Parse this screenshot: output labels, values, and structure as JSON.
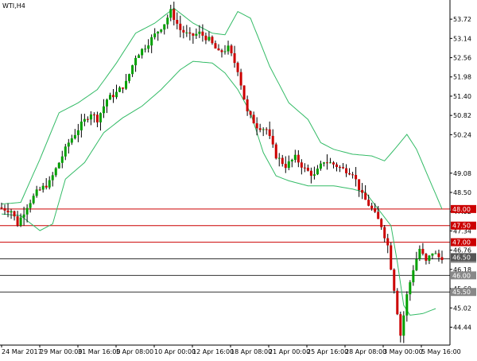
{
  "window": {
    "title": "WTI,H4"
  },
  "colors": {
    "background": "#ffffff",
    "bull": "#00a000",
    "bear": "#cc0000",
    "wick": "#000000",
    "band": "#33bb66",
    "red_level": "#cc0000",
    "gray_level": "#333333",
    "axis": "#000000",
    "label_text": "#ffffff"
  },
  "chart_data": {
    "type": "candlestick",
    "symbol": "WTI",
    "timeframe": "H4",
    "title": "WTI,H4",
    "y_range": [
      43.9,
      54.25
    ],
    "y_ticks": [
      "53.72",
      "53.14",
      "52.56",
      "51.98",
      "51.40",
      "50.82",
      "50.24",
      "49.08",
      "48.50",
      "47.92",
      "47.34",
      "46.76",
      "46.18",
      "45.60",
      "45.02",
      "44.44"
    ],
    "x_labels": [
      "24 Mar 2017",
      "29 Mar 00:00",
      "31 Mar 16:00",
      "5 Apr 08:00",
      "10 Apr 00:00",
      "12 Apr 16:00",
      "18 Apr 08:00",
      "21 Apr 00:00",
      "25 Apr 16:00",
      "28 Apr 08:00",
      "3 May 00:00",
      "5 May 16:00"
    ],
    "levels": [
      {
        "value": 48.0,
        "label": "48.00",
        "kind": "red"
      },
      {
        "value": 47.5,
        "label": "47.50",
        "kind": "red"
      },
      {
        "value": 47.0,
        "label": "47.00",
        "kind": "red"
      },
      {
        "value": 46.5,
        "label": "46.50",
        "kind": "gray"
      },
      {
        "value": 46.0,
        "label": "46.00",
        "kind": "gray"
      },
      {
        "value": 45.5,
        "label": "45.50",
        "kind": "gray"
      }
    ],
    "current_price": {
      "value": 46.55,
      "label": "46.50"
    },
    "price_path": [
      [
        0,
        48.05
      ],
      [
        4,
        47.95
      ],
      [
        6,
        47.55
      ],
      [
        9,
        48.1
      ],
      [
        12,
        48.5
      ],
      [
        16,
        48.8
      ],
      [
        19,
        49.4
      ],
      [
        22,
        50.0
      ],
      [
        26,
        50.55
      ],
      [
        29,
        50.9
      ],
      [
        31,
        50.7
      ],
      [
        34,
        51.3
      ],
      [
        37,
        51.5
      ],
      [
        40,
        51.8
      ],
      [
        43,
        52.6
      ],
      [
        46,
        52.9
      ],
      [
        49,
        53.25
      ],
      [
        52,
        53.6
      ],
      [
        54,
        53.95
      ],
      [
        57,
        53.4
      ],
      [
        60,
        53.2
      ],
      [
        63,
        53.3
      ],
      [
        66,
        53.1
      ],
      [
        69,
        52.7
      ],
      [
        72,
        52.85
      ],
      [
        75,
        52.2
      ],
      [
        78,
        50.9
      ],
      [
        81,
        50.5
      ],
      [
        84,
        50.4
      ],
      [
        87,
        49.6
      ],
      [
        90,
        49.3
      ],
      [
        93,
        49.55
      ],
      [
        96,
        49.2
      ],
      [
        99,
        49.0
      ],
      [
        102,
        49.45
      ],
      [
        105,
        49.35
      ],
      [
        108,
        49.2
      ],
      [
        111,
        49.1
      ],
      [
        114,
        48.4
      ],
      [
        117,
        48.0
      ],
      [
        120,
        47.5
      ],
      [
        122,
        46.9
      ],
      [
        124,
        45.6
      ],
      [
        126,
        44.2
      ],
      [
        128,
        45.4
      ],
      [
        130,
        46.2
      ],
      [
        132,
        46.8
      ],
      [
        134,
        46.4
      ],
      [
        136,
        46.7
      ],
      [
        138,
        46.55
      ]
    ],
    "upper_band": [
      [
        0,
        48.15
      ],
      [
        6,
        48.2
      ],
      [
        12,
        49.5
      ],
      [
        18,
        50.9
      ],
      [
        24,
        51.2
      ],
      [
        30,
        51.6
      ],
      [
        36,
        52.4
      ],
      [
        42,
        53.3
      ],
      [
        48,
        53.6
      ],
      [
        54,
        54.05
      ],
      [
        60,
        53.6
      ],
      [
        66,
        53.3
      ],
      [
        70,
        53.25
      ],
      [
        74,
        53.95
      ],
      [
        78,
        53.75
      ],
      [
        84,
        52.3
      ],
      [
        90,
        51.2
      ],
      [
        96,
        50.7
      ],
      [
        100,
        50.0
      ],
      [
        104,
        49.8
      ],
      [
        110,
        49.65
      ],
      [
        116,
        49.6
      ],
      [
        120,
        49.45
      ],
      [
        124,
        49.9
      ],
      [
        127,
        50.25
      ],
      [
        130,
        49.8
      ],
      [
        134,
        48.9
      ],
      [
        138,
        48.0
      ]
    ],
    "lower_band": [
      [
        0,
        47.85
      ],
      [
        6,
        47.8
      ],
      [
        12,
        47.35
      ],
      [
        16,
        47.55
      ],
      [
        20,
        48.9
      ],
      [
        26,
        49.4
      ],
      [
        32,
        50.3
      ],
      [
        38,
        50.75
      ],
      [
        44,
        51.1
      ],
      [
        50,
        51.6
      ],
      [
        56,
        52.2
      ],
      [
        60,
        52.45
      ],
      [
        66,
        52.4
      ],
      [
        70,
        52.1
      ],
      [
        74,
        51.6
      ],
      [
        78,
        50.9
      ],
      [
        82,
        49.7
      ],
      [
        86,
        49.0
      ],
      [
        90,
        48.85
      ],
      [
        96,
        48.7
      ],
      [
        104,
        48.7
      ],
      [
        110,
        48.6
      ],
      [
        114,
        48.5
      ],
      [
        118,
        48.0
      ],
      [
        122,
        47.5
      ],
      [
        124,
        46.4
      ],
      [
        126,
        45.1
      ],
      [
        128,
        44.8
      ],
      [
        132,
        44.85
      ],
      [
        136,
        45.0
      ]
    ]
  }
}
